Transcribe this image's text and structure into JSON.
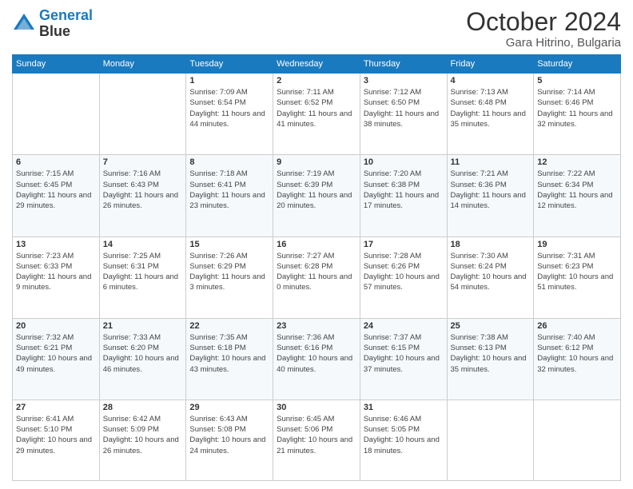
{
  "header": {
    "logo_line1": "General",
    "logo_line2": "Blue",
    "title": "October 2024",
    "subtitle": "Gara Hitrino, Bulgaria"
  },
  "weekdays": [
    "Sunday",
    "Monday",
    "Tuesday",
    "Wednesday",
    "Thursday",
    "Friday",
    "Saturday"
  ],
  "weeks": [
    [
      {
        "day": "",
        "sunrise": "",
        "sunset": "",
        "daylight": ""
      },
      {
        "day": "",
        "sunrise": "",
        "sunset": "",
        "daylight": ""
      },
      {
        "day": "1",
        "sunrise": "Sunrise: 7:09 AM",
        "sunset": "Sunset: 6:54 PM",
        "daylight": "Daylight: 11 hours and 44 minutes."
      },
      {
        "day": "2",
        "sunrise": "Sunrise: 7:11 AM",
        "sunset": "Sunset: 6:52 PM",
        "daylight": "Daylight: 11 hours and 41 minutes."
      },
      {
        "day": "3",
        "sunrise": "Sunrise: 7:12 AM",
        "sunset": "Sunset: 6:50 PM",
        "daylight": "Daylight: 11 hours and 38 minutes."
      },
      {
        "day": "4",
        "sunrise": "Sunrise: 7:13 AM",
        "sunset": "Sunset: 6:48 PM",
        "daylight": "Daylight: 11 hours and 35 minutes."
      },
      {
        "day": "5",
        "sunrise": "Sunrise: 7:14 AM",
        "sunset": "Sunset: 6:46 PM",
        "daylight": "Daylight: 11 hours and 32 minutes."
      }
    ],
    [
      {
        "day": "6",
        "sunrise": "Sunrise: 7:15 AM",
        "sunset": "Sunset: 6:45 PM",
        "daylight": "Daylight: 11 hours and 29 minutes."
      },
      {
        "day": "7",
        "sunrise": "Sunrise: 7:16 AM",
        "sunset": "Sunset: 6:43 PM",
        "daylight": "Daylight: 11 hours and 26 minutes."
      },
      {
        "day": "8",
        "sunrise": "Sunrise: 7:18 AM",
        "sunset": "Sunset: 6:41 PM",
        "daylight": "Daylight: 11 hours and 23 minutes."
      },
      {
        "day": "9",
        "sunrise": "Sunrise: 7:19 AM",
        "sunset": "Sunset: 6:39 PM",
        "daylight": "Daylight: 11 hours and 20 minutes."
      },
      {
        "day": "10",
        "sunrise": "Sunrise: 7:20 AM",
        "sunset": "Sunset: 6:38 PM",
        "daylight": "Daylight: 11 hours and 17 minutes."
      },
      {
        "day": "11",
        "sunrise": "Sunrise: 7:21 AM",
        "sunset": "Sunset: 6:36 PM",
        "daylight": "Daylight: 11 hours and 14 minutes."
      },
      {
        "day": "12",
        "sunrise": "Sunrise: 7:22 AM",
        "sunset": "Sunset: 6:34 PM",
        "daylight": "Daylight: 11 hours and 12 minutes."
      }
    ],
    [
      {
        "day": "13",
        "sunrise": "Sunrise: 7:23 AM",
        "sunset": "Sunset: 6:33 PM",
        "daylight": "Daylight: 11 hours and 9 minutes."
      },
      {
        "day": "14",
        "sunrise": "Sunrise: 7:25 AM",
        "sunset": "Sunset: 6:31 PM",
        "daylight": "Daylight: 11 hours and 6 minutes."
      },
      {
        "day": "15",
        "sunrise": "Sunrise: 7:26 AM",
        "sunset": "Sunset: 6:29 PM",
        "daylight": "Daylight: 11 hours and 3 minutes."
      },
      {
        "day": "16",
        "sunrise": "Sunrise: 7:27 AM",
        "sunset": "Sunset: 6:28 PM",
        "daylight": "Daylight: 11 hours and 0 minutes."
      },
      {
        "day": "17",
        "sunrise": "Sunrise: 7:28 AM",
        "sunset": "Sunset: 6:26 PM",
        "daylight": "Daylight: 10 hours and 57 minutes."
      },
      {
        "day": "18",
        "sunrise": "Sunrise: 7:30 AM",
        "sunset": "Sunset: 6:24 PM",
        "daylight": "Daylight: 10 hours and 54 minutes."
      },
      {
        "day": "19",
        "sunrise": "Sunrise: 7:31 AM",
        "sunset": "Sunset: 6:23 PM",
        "daylight": "Daylight: 10 hours and 51 minutes."
      }
    ],
    [
      {
        "day": "20",
        "sunrise": "Sunrise: 7:32 AM",
        "sunset": "Sunset: 6:21 PM",
        "daylight": "Daylight: 10 hours and 49 minutes."
      },
      {
        "day": "21",
        "sunrise": "Sunrise: 7:33 AM",
        "sunset": "Sunset: 6:20 PM",
        "daylight": "Daylight: 10 hours and 46 minutes."
      },
      {
        "day": "22",
        "sunrise": "Sunrise: 7:35 AM",
        "sunset": "Sunset: 6:18 PM",
        "daylight": "Daylight: 10 hours and 43 minutes."
      },
      {
        "day": "23",
        "sunrise": "Sunrise: 7:36 AM",
        "sunset": "Sunset: 6:16 PM",
        "daylight": "Daylight: 10 hours and 40 minutes."
      },
      {
        "day": "24",
        "sunrise": "Sunrise: 7:37 AM",
        "sunset": "Sunset: 6:15 PM",
        "daylight": "Daylight: 10 hours and 37 minutes."
      },
      {
        "day": "25",
        "sunrise": "Sunrise: 7:38 AM",
        "sunset": "Sunset: 6:13 PM",
        "daylight": "Daylight: 10 hours and 35 minutes."
      },
      {
        "day": "26",
        "sunrise": "Sunrise: 7:40 AM",
        "sunset": "Sunset: 6:12 PM",
        "daylight": "Daylight: 10 hours and 32 minutes."
      }
    ],
    [
      {
        "day": "27",
        "sunrise": "Sunrise: 6:41 AM",
        "sunset": "Sunset: 5:10 PM",
        "daylight": "Daylight: 10 hours and 29 minutes."
      },
      {
        "day": "28",
        "sunrise": "Sunrise: 6:42 AM",
        "sunset": "Sunset: 5:09 PM",
        "daylight": "Daylight: 10 hours and 26 minutes."
      },
      {
        "day": "29",
        "sunrise": "Sunrise: 6:43 AM",
        "sunset": "Sunset: 5:08 PM",
        "daylight": "Daylight: 10 hours and 24 minutes."
      },
      {
        "day": "30",
        "sunrise": "Sunrise: 6:45 AM",
        "sunset": "Sunset: 5:06 PM",
        "daylight": "Daylight: 10 hours and 21 minutes."
      },
      {
        "day": "31",
        "sunrise": "Sunrise: 6:46 AM",
        "sunset": "Sunset: 5:05 PM",
        "daylight": "Daylight: 10 hours and 18 minutes."
      },
      {
        "day": "",
        "sunrise": "",
        "sunset": "",
        "daylight": ""
      },
      {
        "day": "",
        "sunrise": "",
        "sunset": "",
        "daylight": ""
      }
    ]
  ]
}
